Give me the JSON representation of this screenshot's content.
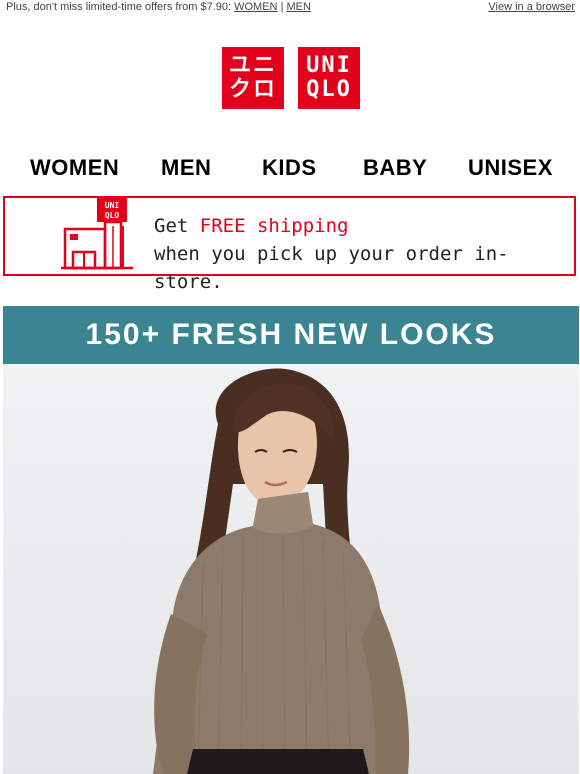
{
  "preheader": {
    "text": "Plus, don't miss limited-time offers from $7.90:",
    "link_women": "WOMEN",
    "separator": "|",
    "link_men": "MEN",
    "view_browser": "View in a browser"
  },
  "logo": {
    "katakana_line1": "ユニ",
    "katakana_line2": "クロ",
    "latin_line1": "UNI",
    "latin_line2": "QLO"
  },
  "nav": {
    "women": "WOMEN",
    "men": "MEN",
    "kids": "KIDS",
    "baby": "BABY",
    "unisex": "UNISEX"
  },
  "shipping_banner": {
    "icon_label_line1": "UNI",
    "icon_label_line2": "QLO",
    "get": "Get",
    "free": "FREE shipping",
    "line2": "when you pick up your order in-store."
  },
  "hero": {
    "title": "150+ FRESH NEW LOOKS"
  },
  "colors": {
    "brand_red": "#e3001b",
    "hero_band": "#3b8592"
  }
}
